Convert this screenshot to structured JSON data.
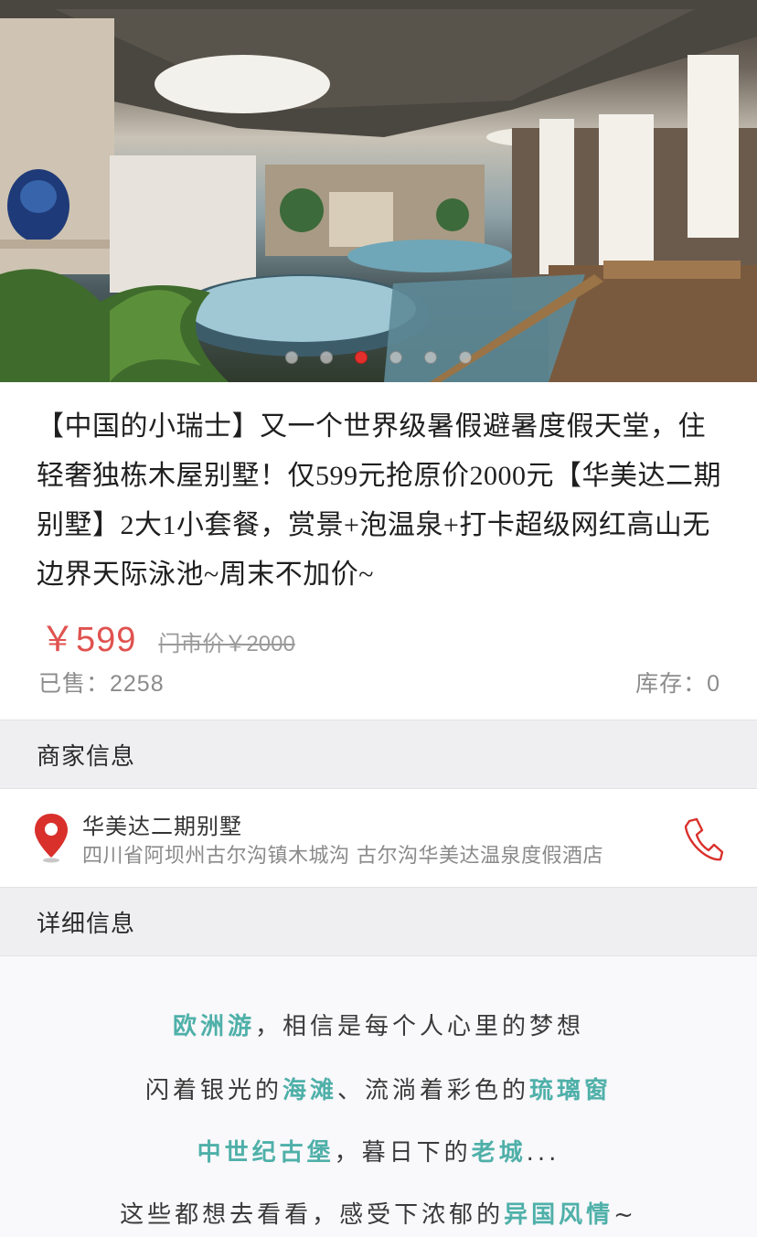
{
  "hero": {
    "image": "resort indoor hot spring pool with wooden ceiling, stone walls and curtained pavilion",
    "carousel": {
      "count": 6,
      "active": 3
    }
  },
  "product": {
    "title": "【中国的小瑞士】又一个世界级暑假避暑度假天堂，住轻奢独栋木屋别墅！仅599元抢原价2000元【华美达二期别墅】2大1小套餐，赏景+泡温泉+打卡超级网红高山无边界天际泳池~周末不加价~",
    "price": "￥599",
    "original_price": "门市价￥2000",
    "sold": "已售：2258",
    "stock": "库存：0"
  },
  "merchant_section": {
    "header": "商家信息",
    "name": "华美达二期别墅",
    "address": "四川省阿坝州古尔沟镇木城沟 古尔沟华美达温泉度假酒店",
    "location_icon": "map-pin-icon",
    "phone_icon": "phone-icon"
  },
  "detail_section": {
    "header": "详细信息",
    "lines": [
      {
        "hl1": "欧洲游",
        "t1": "，相信是每个人心里的梦想"
      },
      {
        "t1": "闪着银光的",
        "hl1": "海滩",
        "t2": "、流淌着彩色的",
        "hl2": "琉璃窗"
      },
      {
        "hl1": "中世纪古堡",
        "t1": "，暮日下的",
        "hl2": "老城",
        "t2": "..."
      },
      {
        "t1": "这些都想去看看，感受下浓郁的",
        "hl1": "异国风情",
        "t2": "~"
      }
    ]
  },
  "colors": {
    "price": "#e0524f",
    "highlight": "#4fb0a9",
    "icon_red": "#d9302c",
    "section_bg": "#efeff1",
    "carousel_active": "#e2312d"
  }
}
